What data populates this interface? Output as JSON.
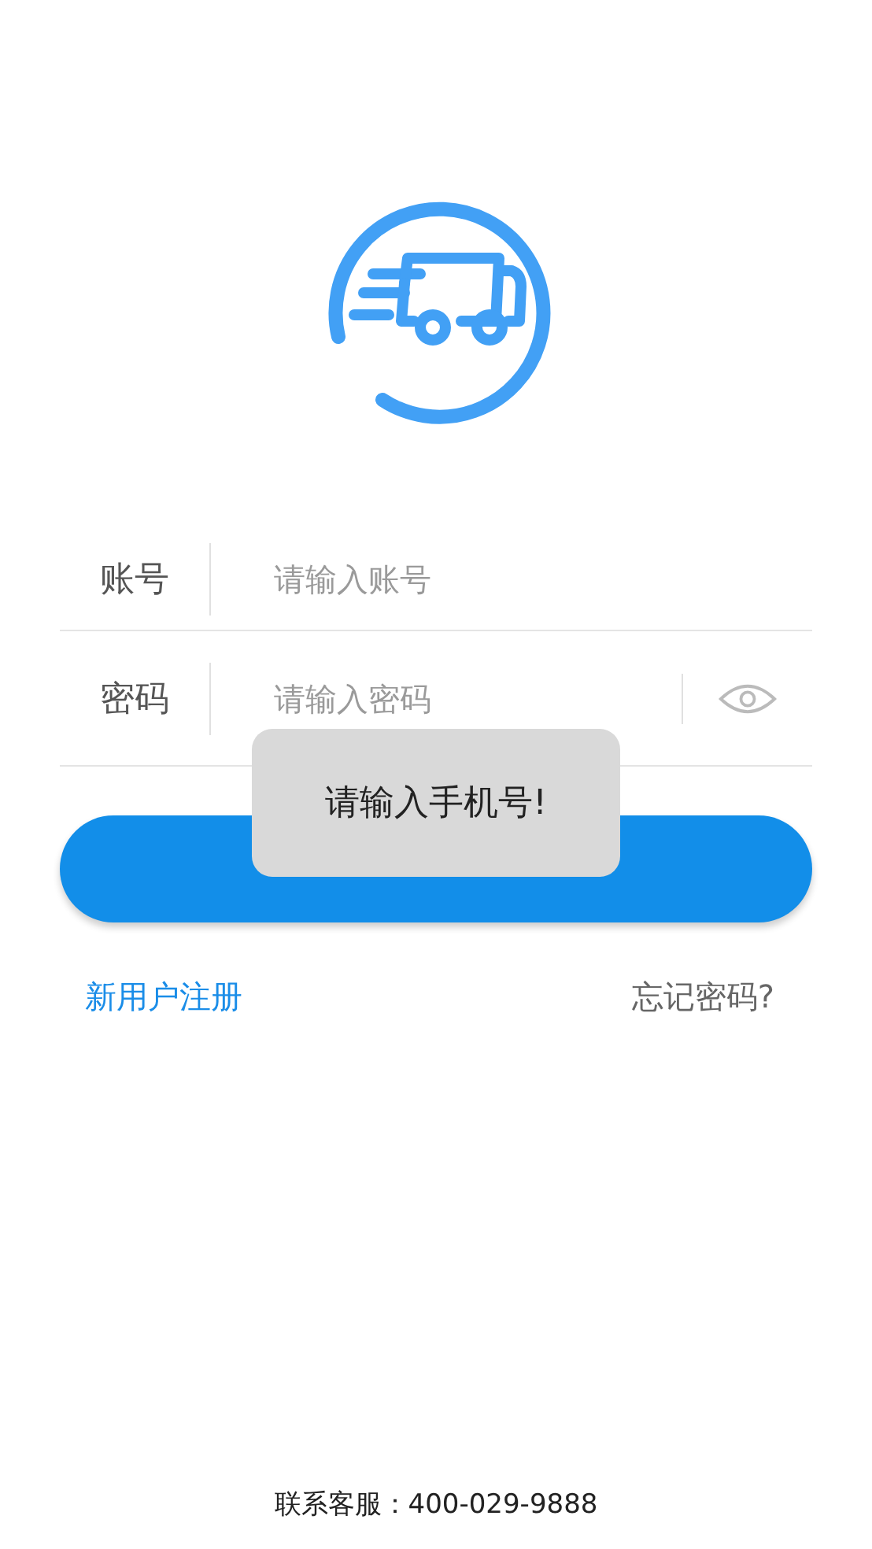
{
  "form": {
    "fields": [
      {
        "label": "账号",
        "placeholder": "请输入账号",
        "kind": "text"
      },
      {
        "label": "密码",
        "placeholder": "请输入密码",
        "kind": "password"
      }
    ]
  },
  "links": {
    "register": "新用户注册",
    "forgot": "忘记密码?"
  },
  "toast": {
    "message": "请输入手机号!"
  },
  "footer": {
    "contact": "联系客服：400-029-9888"
  }
}
